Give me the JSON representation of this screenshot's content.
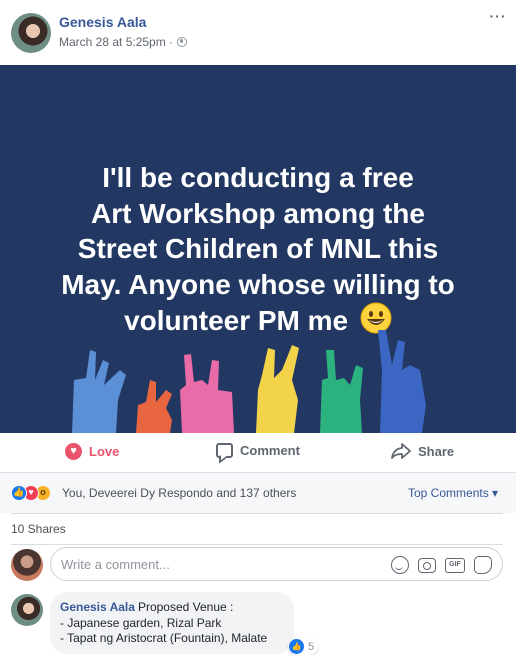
{
  "post": {
    "author": "Genesis Aala",
    "timestamp": "March 28 at 5:25pm ·",
    "privacy_icon": "globe-icon",
    "more_label": "···",
    "text_lines": [
      "I'll be conducting a free",
      "Art Workshop among the",
      "Street Children of MNL this",
      "May. Anyone whose willing to",
      "volunteer PM me"
    ],
    "background_color": "#223761",
    "hand_colors": [
      "#5b8fd6",
      "#e8663f",
      "#e96ca8",
      "#f3d34a",
      "#2cb27f",
      "#3c66c4"
    ]
  },
  "actions": {
    "love": "Love",
    "comment": "Comment",
    "share": "Share",
    "love_color": "#e9546b"
  },
  "reactions": {
    "icons": [
      "like-icon",
      "love-icon",
      "wow-icon"
    ],
    "summary": "You, Deveerei Dy Respondo and 137 others",
    "top_comments": "Top Comments ▾"
  },
  "shares": "10 Shares",
  "composer": {
    "placeholder": "Write a comment...",
    "icons": [
      "smile-icon",
      "camera-icon",
      "gif-icon",
      "sticker-icon"
    ],
    "gif_label": "GIF"
  },
  "comment": {
    "author": "Genesis Aala",
    "text_intro": "Proposed Venue :",
    "lines": [
      "- Japanese garden, Rizal Park",
      "- Tapat ng Aristocrat (Fountain), Malate"
    ],
    "like_count": "5"
  }
}
